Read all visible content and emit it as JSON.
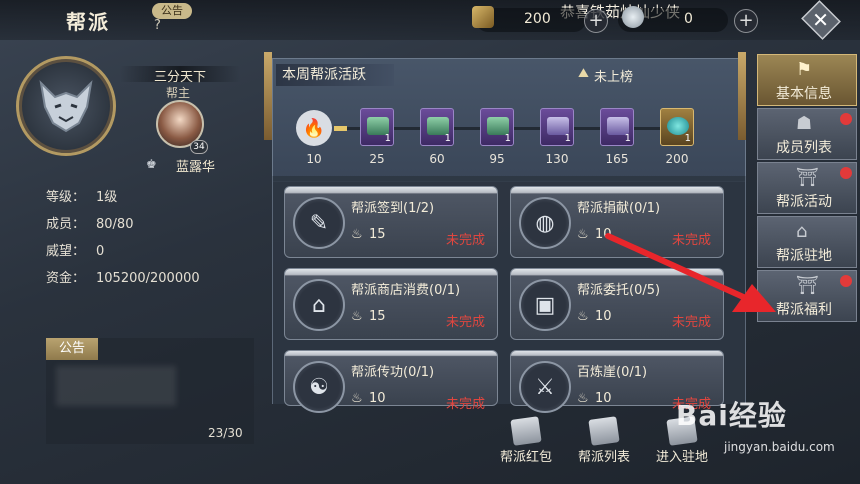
{
  "header": {
    "title": "帮派",
    "notice_tag": "公告",
    "marquee": "恭喜铁茹灿灿少侠",
    "currency1_value": "200",
    "currency2_value": "0",
    "close_icon": "close-icon"
  },
  "guild": {
    "name": "三分天下",
    "leader_label": "帮主",
    "leader_name": "蓝露华",
    "leader_level": "34",
    "stats": [
      {
        "key": "等级：",
        "value": "1级"
      },
      {
        "key": "成员：",
        "value": "80/80"
      },
      {
        "key": "威望：",
        "value": "0"
      },
      {
        "key": "资金：",
        "value": "105200/200000"
      }
    ],
    "notice_header": "公告",
    "notice_count": "23/30"
  },
  "weekly": {
    "title": "本周帮派活跃",
    "rank_status": "未上榜",
    "current": "10",
    "milestones": [
      {
        "points": "25",
        "count": "1",
        "kind": "green-chest"
      },
      {
        "points": "60",
        "count": "1",
        "kind": "green-chest"
      },
      {
        "points": "95",
        "count": "1",
        "kind": "green-chest"
      },
      {
        "points": "130",
        "count": "1",
        "kind": "purple-chest"
      },
      {
        "points": "165",
        "count": "1",
        "kind": "purple-chest"
      },
      {
        "points": "200",
        "count": "1",
        "kind": "gem"
      }
    ],
    "progress_fraction": 0.04
  },
  "tasks": [
    {
      "name": "帮派签到(1/2)",
      "points": "15",
      "status": "未完成",
      "icon": "feather-icon"
    },
    {
      "name": "帮派捐献(0/1)",
      "points": "10",
      "status": "未完成",
      "icon": "money-bag-icon"
    },
    {
      "name": "帮派商店消费(0/1)",
      "points": "15",
      "status": "未完成",
      "icon": "shop-icon"
    },
    {
      "name": "帮派委托(0/5)",
      "points": "10",
      "status": "未完成",
      "icon": "chest-icon"
    },
    {
      "name": "帮派传功(0/1)",
      "points": "10",
      "status": "未完成",
      "icon": "meditation-icon"
    },
    {
      "name": "百炼崖(0/1)",
      "points": "10",
      "status": "未完成",
      "icon": "swords-icon"
    }
  ],
  "bottom_buttons": [
    {
      "label": "帮派红包"
    },
    {
      "label": "帮派列表"
    },
    {
      "label": "进入驻地"
    }
  ],
  "tabs": [
    {
      "label": "基本信息",
      "active": true,
      "dot": false
    },
    {
      "label": "成员列表",
      "active": false,
      "dot": true
    },
    {
      "label": "帮派活动",
      "active": false,
      "dot": true
    },
    {
      "label": "帮派驻地",
      "active": false,
      "dot": false
    },
    {
      "label": "帮派福利",
      "active": false,
      "dot": true
    }
  ],
  "watermark": {
    "main": "Bai经验",
    "sub": "jingyan.baidu.com"
  },
  "colors": {
    "accent_gold": "#b39a62",
    "status_red": "#e0463f",
    "arrow_red": "#e8262b"
  }
}
